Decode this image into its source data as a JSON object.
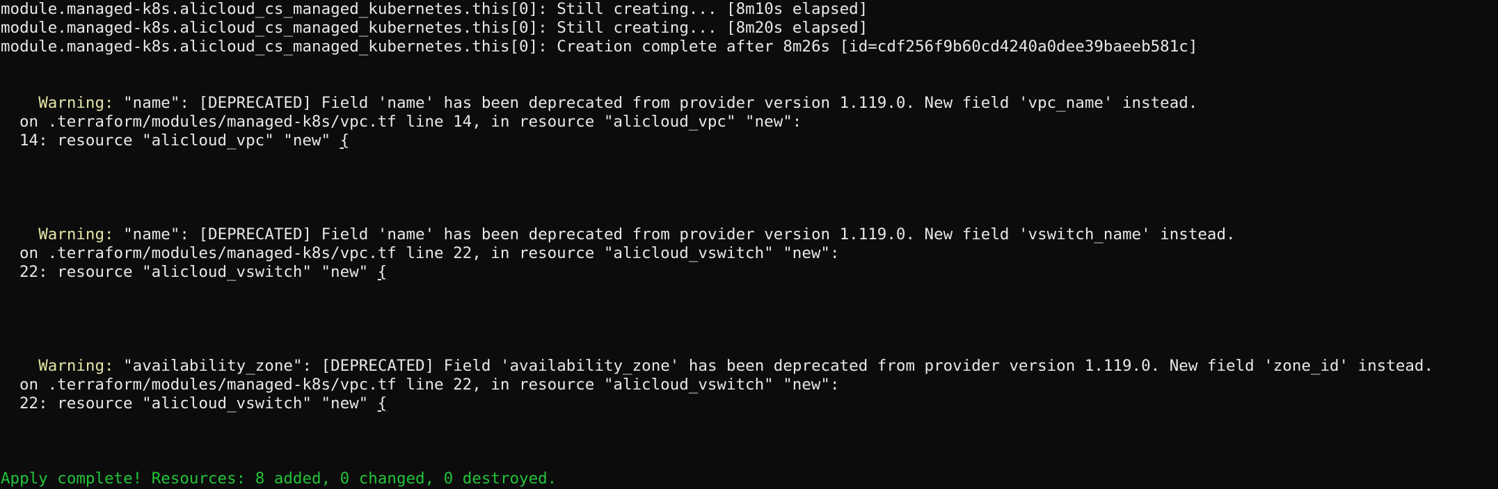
{
  "terminal": {
    "progress": [
      "module.managed-k8s.alicloud_cs_managed_kubernetes.this[0]: Still creating... [8m10s elapsed]",
      "module.managed-k8s.alicloud_cs_managed_kubernetes.this[0]: Still creating... [8m20s elapsed]",
      "module.managed-k8s.alicloud_cs_managed_kubernetes.this[0]: Creation complete after 8m26s [id=cdf256f9b60cd4240a0dee39baeeb581c]"
    ],
    "warnings": [
      {
        "label": "Warning:",
        "message": " \"name\": [DEPRECATED] Field 'name' has been deprecated from provider version 1.119.0. New field 'vpc_name' instead.",
        "location": "on .terraform/modules/managed-k8s/vpc.tf line 14, in resource \"alicloud_vpc\" \"new\":",
        "code": "14: resource \"alicloud_vpc\" \"new\" ",
        "brace": "{"
      },
      {
        "label": "Warning:",
        "message": " \"name\": [DEPRECATED] Field 'name' has been deprecated from provider version 1.119.0. New field 'vswitch_name' instead.",
        "location": "on .terraform/modules/managed-k8s/vpc.tf line 22, in resource \"alicloud_vswitch\" \"new\":",
        "code": "22: resource \"alicloud_vswitch\" \"new\" ",
        "brace": "{"
      },
      {
        "label": "Warning:",
        "message": " \"availability_zone\": [DEPRECATED] Field 'availability_zone' has been deprecated from provider version 1.119.0. New field 'zone_id' instead.",
        "location": "on .terraform/modules/managed-k8s/vpc.tf line 22, in resource \"alicloud_vswitch\" \"new\":",
        "code": "22: resource \"alicloud_vswitch\" \"new\" ",
        "brace": "{"
      }
    ],
    "summary": "Apply complete! Resources: 8 added, 0 changed, 0 destroyed."
  },
  "colors": {
    "background": "#0c0c0c",
    "text": "#e8e8e8",
    "warning": "#e5e5a6",
    "success": "#23c33a"
  }
}
